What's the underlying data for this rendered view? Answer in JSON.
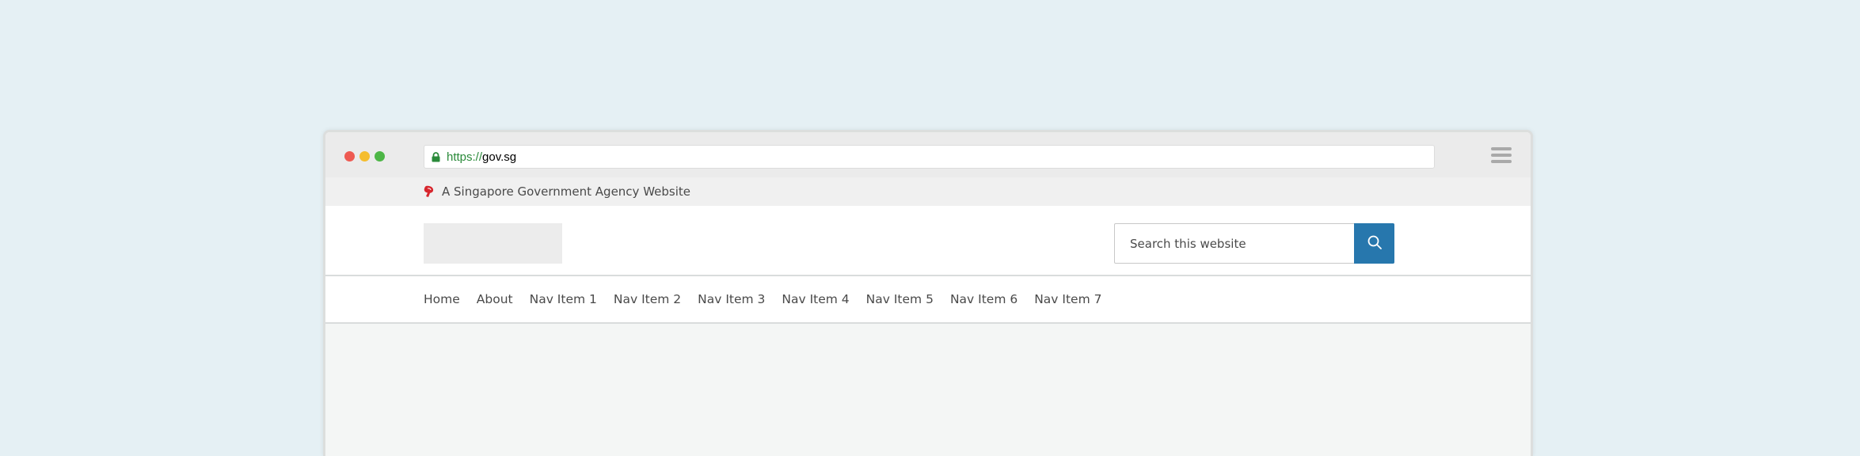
{
  "browser": {
    "url_scheme": "https://",
    "url_host": "gov.sg"
  },
  "masthead": {
    "text": "A Singapore Government Agency Website"
  },
  "search": {
    "placeholder": "Search this website"
  },
  "nav": {
    "items": [
      {
        "label": "Home"
      },
      {
        "label": "About"
      },
      {
        "label": "Nav Item 1"
      },
      {
        "label": "Nav Item 2"
      },
      {
        "label": "Nav Item 3"
      },
      {
        "label": "Nav Item 4"
      },
      {
        "label": "Nav Item 5"
      },
      {
        "label": "Nav Item 6"
      },
      {
        "label": "Nav Item 7"
      }
    ]
  },
  "colors": {
    "accent": "#2777ad",
    "secure_green": "#2a8a3a",
    "lion_red": "#d7262d"
  },
  "icons": {
    "lock": "lock-icon",
    "lion": "lion-head-icon",
    "search": "search-icon",
    "menu": "hamburger-menu-icon"
  }
}
